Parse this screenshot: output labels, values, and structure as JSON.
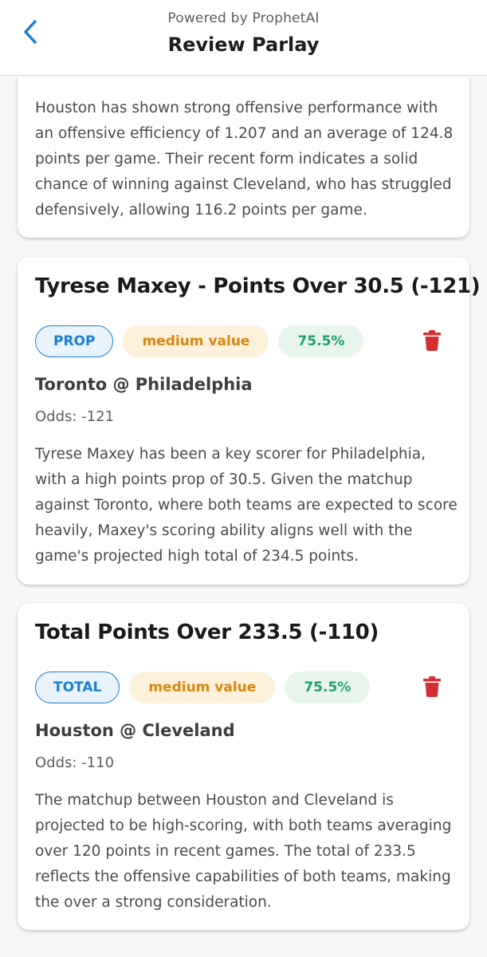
{
  "header": {
    "powered_by": "Powered by ProphetAI",
    "title": "Review Parlay",
    "back_icon": "chevron-left-icon",
    "accent": "#1c7fd0"
  },
  "summary_card": {
    "reasoning": "Houston has shown strong offensive performance with an offensive efficiency of 1.207 and an average of 124.8 points per game. Their recent form indicates a solid chance of winning against Cleveland, who has struggled defensively, allowing 116.2 points per game."
  },
  "bets": [
    {
      "title": "Tyrese Maxey - Points Over 30.5 (-121)",
      "type": "PROP",
      "value": "medium value",
      "confidence": "75.5%",
      "matchup": "Toronto @ Philadelphia",
      "odds": "Odds: -121",
      "reasoning": "Tyrese Maxey has been a key scorer for Philadelphia, with a high points prop of 30.5. Given the matchup against Toronto, where both teams are expected to score heavily, Maxey's scoring ability aligns well with the game's projected high total of 234.5 points."
    },
    {
      "title": "Total Points Over 233.5 (-110)",
      "type": "TOTAL",
      "value": "medium value",
      "confidence": "75.5%",
      "matchup": "Houston @ Cleveland",
      "odds": "Odds: -110",
      "reasoning": "The matchup between Houston and Cleveland is projected to be high-scoring, with both teams averaging over 120 points in recent games. The total of 233.5 reflects the offensive capabilities of both teams, making the over a strong consideration."
    }
  ],
  "colors": {
    "type_badge": "#1c7fd0",
    "value_badge": "#d8870c",
    "confidence_badge": "#22a06b",
    "delete_icon": "#d32f2f"
  }
}
